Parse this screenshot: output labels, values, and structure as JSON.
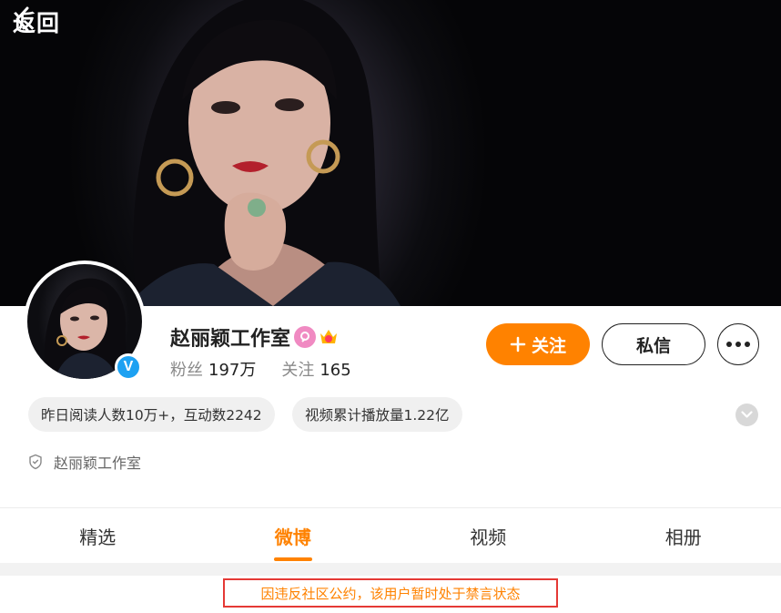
{
  "nav": {
    "back_label": "返回",
    "back_icon": "chevron-left-icon"
  },
  "profile": {
    "name": "赵丽颖工作室",
    "verified_mark": "V",
    "fans_label": "粉丝",
    "fans_value": "197万",
    "following_label": "关注",
    "following_value": "165",
    "badges": [
      "female-badge-icon",
      "crown-badge-icon"
    ]
  },
  "actions": {
    "follow_label": "关注",
    "follow_icon": "plus-icon",
    "message_label": "私信",
    "more_icon": "more-dots-icon"
  },
  "highlights": [
    "昨日阅读人数10万+，互动数2242",
    "视频累计播放量1.22亿"
  ],
  "organization": {
    "icon": "shield-icon",
    "label": "赵丽颖工作室"
  },
  "tabs": [
    {
      "label": "精选",
      "active": false
    },
    {
      "label": "微博",
      "active": true
    },
    {
      "label": "视频",
      "active": false
    },
    {
      "label": "相册",
      "active": false
    }
  ],
  "notice": "因违反社区公约，该用户暂时处于禁言状态",
  "colors": {
    "accent": "#ff8200",
    "verified": "#1da1f2",
    "notice_border": "#e53935"
  }
}
